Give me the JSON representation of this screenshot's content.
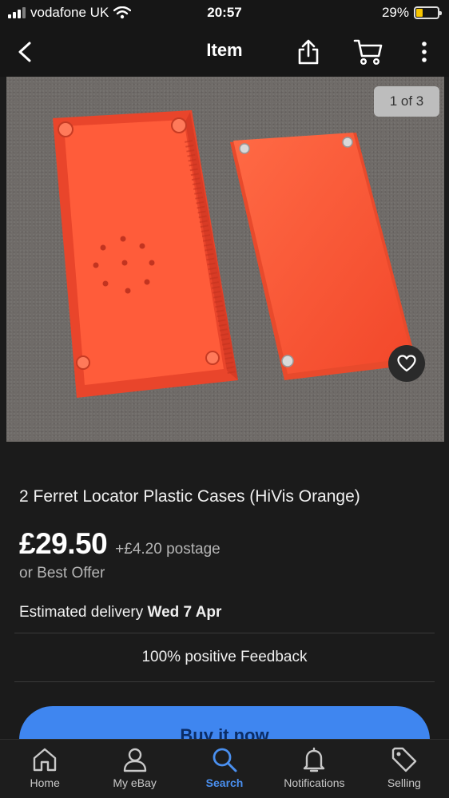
{
  "status_bar": {
    "carrier": "vodafone UK",
    "time": "20:57",
    "battery_percent": "29%",
    "battery_level": 0.29
  },
  "nav": {
    "title": "Item"
  },
  "gallery": {
    "counter": "1 of 3"
  },
  "item": {
    "title": "2 Ferret Locator Plastic Cases (HiVis Orange)",
    "price": "£29.50",
    "postage": "+£4.20 postage",
    "best_offer": "or Best Offer",
    "delivery_label": "Estimated delivery ",
    "delivery_date": "Wed 7 Apr",
    "feedback": "100% positive Feedback",
    "buy_label": "Buy it now"
  },
  "tabs": [
    {
      "label": "Home",
      "icon": "home-icon"
    },
    {
      "label": "My eBay",
      "icon": "person-icon"
    },
    {
      "label": "Search",
      "icon": "search-icon",
      "active": true
    },
    {
      "label": "Notifications",
      "icon": "bell-icon"
    },
    {
      "label": "Selling",
      "icon": "tag-icon"
    }
  ],
  "colors": {
    "accent": "#3f86f0",
    "active_tab": "#4a90f0",
    "product_orange": "#ff5a36"
  }
}
